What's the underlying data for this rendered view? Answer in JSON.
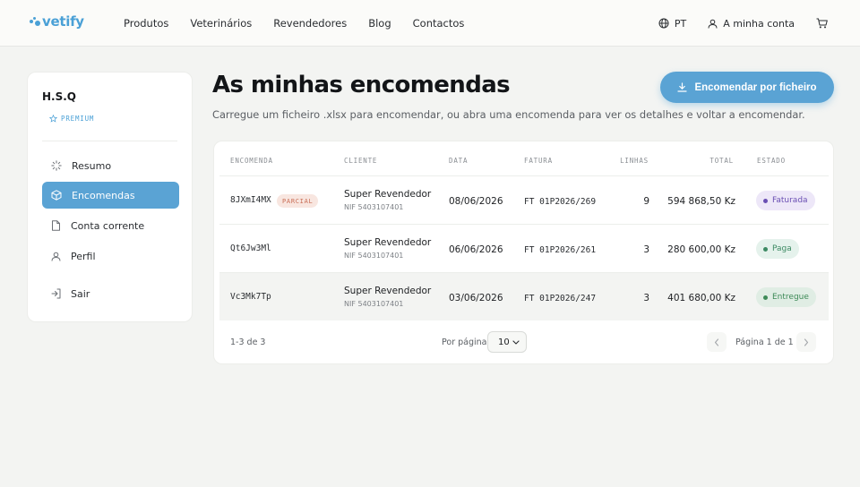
{
  "brand": {
    "name": "vetify",
    "color": "#4aa0d6"
  },
  "nav": {
    "links": [
      "Produtos",
      "Veterinários",
      "Revendedores",
      "Blog",
      "Contactos"
    ],
    "language": "PT",
    "account": "A minha conta",
    "icons": [
      "globe-icon",
      "user-icon",
      "cart-icon"
    ]
  },
  "sidebar": {
    "org": "H.S.Q",
    "tier": "PREMIUM",
    "items": [
      {
        "label": "Resumo",
        "icon": "loader-icon",
        "active": false
      },
      {
        "label": "Encomendas",
        "icon": "box-icon",
        "active": true
      },
      {
        "label": "Conta corrente",
        "icon": "file-icon",
        "active": false
      },
      {
        "label": "Perfil",
        "icon": "user-icon",
        "active": false
      }
    ],
    "logout": "Sair"
  },
  "page": {
    "title": "As minhas encomendas",
    "subtitle": "Carregue um ficheiro .xlsx para encomendar, ou abra uma encomenda para ver os detalhes e voltar a encomendar.",
    "cta": "Encomendar por ficheiro"
  },
  "table": {
    "headers": [
      "ENCOMENDA",
      "CLIENTE",
      "DATA",
      "FATURA",
      "LINHAS",
      "TOTAL",
      "ESTADO"
    ],
    "rows": [
      {
        "id": "8JXmI4MX",
        "tag": "PARCIAL",
        "client": "Super Revendedor",
        "nif": "NIF 5403107401",
        "date": "08/06/2026",
        "invoice": "FT 01P2026/269",
        "lines": "9",
        "total": "594 868,50 Kz",
        "status": "Faturada"
      },
      {
        "id": "Qt6Jw3Ml",
        "tag": "",
        "client": "Super Revendedor",
        "nif": "NIF 5403107401",
        "date": "06/06/2026",
        "invoice": "FT 01P2026/261",
        "lines": "3",
        "total": "280 600,00 Kz",
        "status": "Paga"
      },
      {
        "id": "Vc3Mk7Tp",
        "tag": "",
        "client": "Super Revendedor",
        "nif": "NIF 5403107401",
        "date": "03/06/2026",
        "invoice": "FT 01P2026/247",
        "lines": "3",
        "total": "401 680,00 Kz",
        "status": "Entregue"
      }
    ],
    "status_colors": {
      "Faturada": {
        "bg": "#ede7f8",
        "fg": "#6a4fb3"
      },
      "Paga": {
        "bg": "#e5f2ec",
        "fg": "#3d8a63"
      },
      "Entregue": {
        "bg": "#e0ede4",
        "fg": "#3d8a57"
      }
    }
  },
  "footer": {
    "count": "1-3 de 3",
    "per_page_label": "Por página",
    "per_page_value": "10",
    "page_label": "Página 1 de 1"
  }
}
